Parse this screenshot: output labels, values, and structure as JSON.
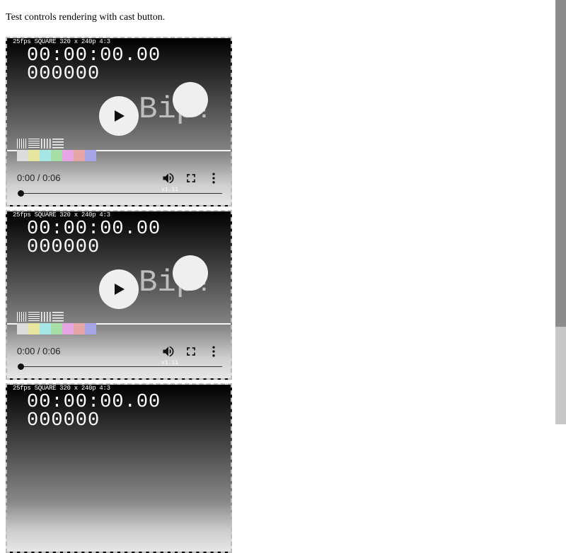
{
  "page": {
    "description": "Test controls rendering with cast button."
  },
  "video": {
    "header": "25fps SQUARE 320 x 240p 4:3",
    "timecode": "00:00:00.00",
    "frames": "000000",
    "bip": "Bip!",
    "time_display": "0:00 / 0:06",
    "version": "v1.11",
    "progress": 0,
    "swatch_colors": [
      "#dcdcdc",
      "#e6e6a0",
      "#a6e6e6",
      "#a6e0a6",
      "#e6a6e6",
      "#e6a6a6",
      "#a6a6e6"
    ],
    "icons": [
      "play-icon",
      "volume-icon",
      "fullscreen-icon",
      "more-options-icon"
    ]
  },
  "scrollbar": {
    "visible_fraction": 0.77
  }
}
